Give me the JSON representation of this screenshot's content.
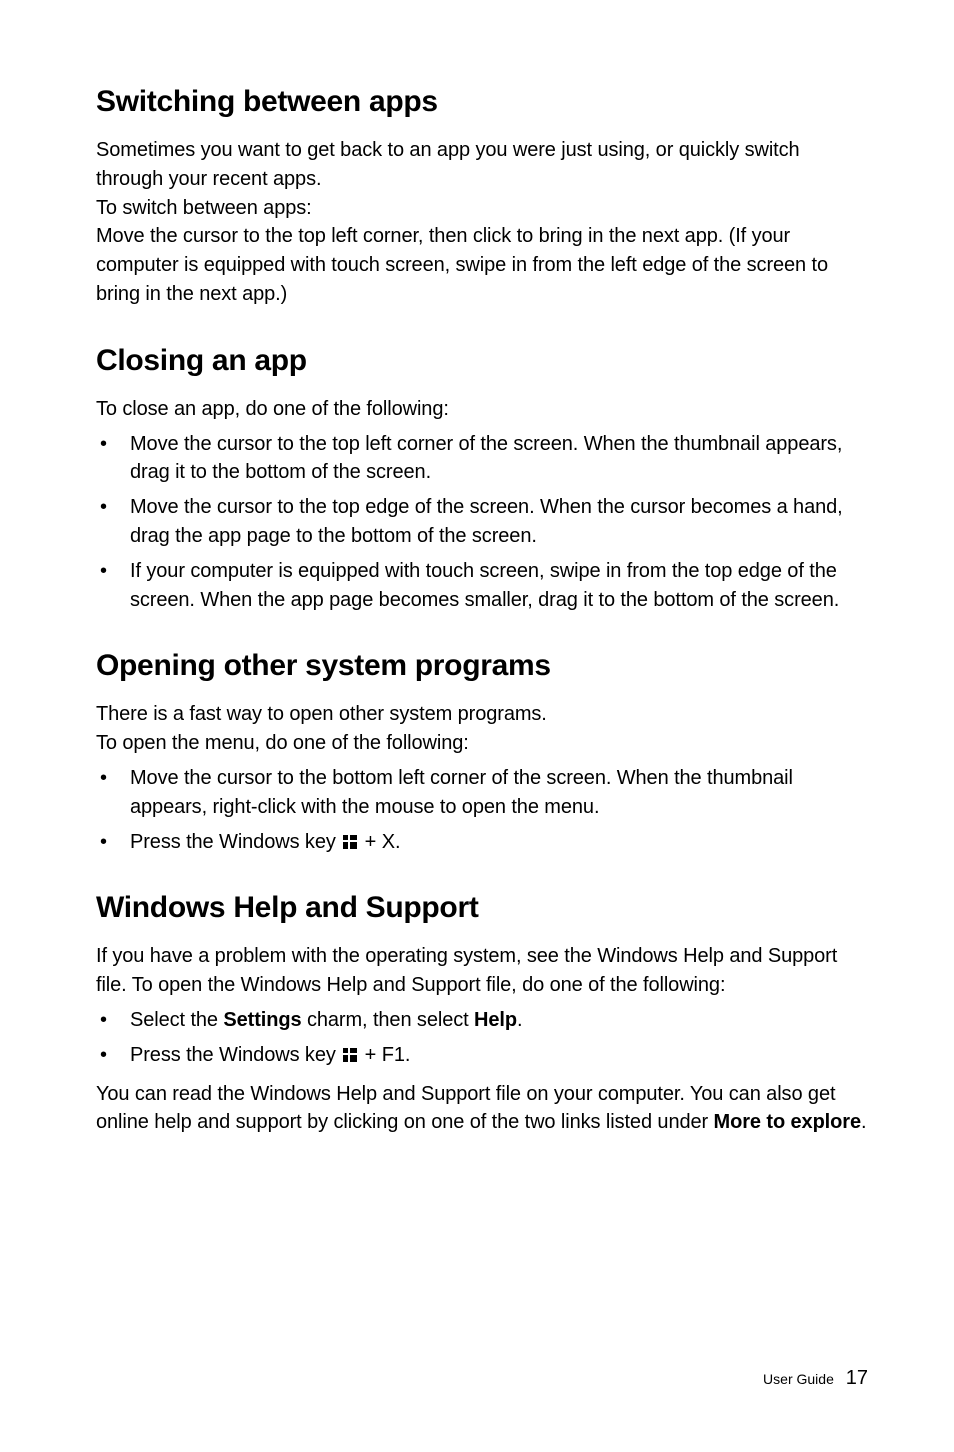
{
  "section1": {
    "heading": "Switching between apps",
    "p1": "Sometimes you want to get back to an app you were just using, or quickly switch through your recent apps.",
    "p2": "To switch between apps:",
    "p3": "Move the cursor to the top left corner, then click to bring in the next app. (If your computer is equipped with touch screen, swipe in from the left edge of the screen to bring in the next app.)"
  },
  "section2": {
    "heading": "Closing an app",
    "intro": "To close an app, do one of the following:",
    "items": [
      "Move the cursor to the top left corner of the screen. When the thumbnail appears, drag it to the bottom of the screen.",
      "Move the cursor to the top edge of the screen. When the cursor becomes a hand, drag the app page to the bottom of the screen.",
      "If your computer is equipped with touch screen, swipe in from the top edge of the screen. When the app page becomes smaller, drag it to the bottom of the screen."
    ]
  },
  "section3": {
    "heading": "Opening other system programs",
    "p1": "There is a fast way to open other system programs.",
    "p2": "To open the menu, do one of the following:",
    "item1": "Move the cursor to the bottom left corner of the screen. When the thumbnail appears, right-click with the mouse to open the menu.",
    "item2_pre": "Press the Windows key ",
    "item2_post": " + X."
  },
  "section4": {
    "heading": "Windows Help and Support",
    "intro": "If you have a problem with the operating system, see the Windows Help and Support file. To open the Windows Help and Support file, do one of the following:",
    "item1_a": "Select the ",
    "item1_b": "Settings",
    "item1_c": " charm, then select ",
    "item1_d": "Help",
    "item1_e": ".",
    "item2_pre": "Press the Windows key ",
    "item2_post": " + F1.",
    "outro_a": "You can read the Windows Help and Support file on your computer. You can also get online help and support by clicking on one of the two links listed under ",
    "outro_b": "More to explore",
    "outro_c": "."
  },
  "footer": {
    "label": "User Guide",
    "page": "17"
  }
}
